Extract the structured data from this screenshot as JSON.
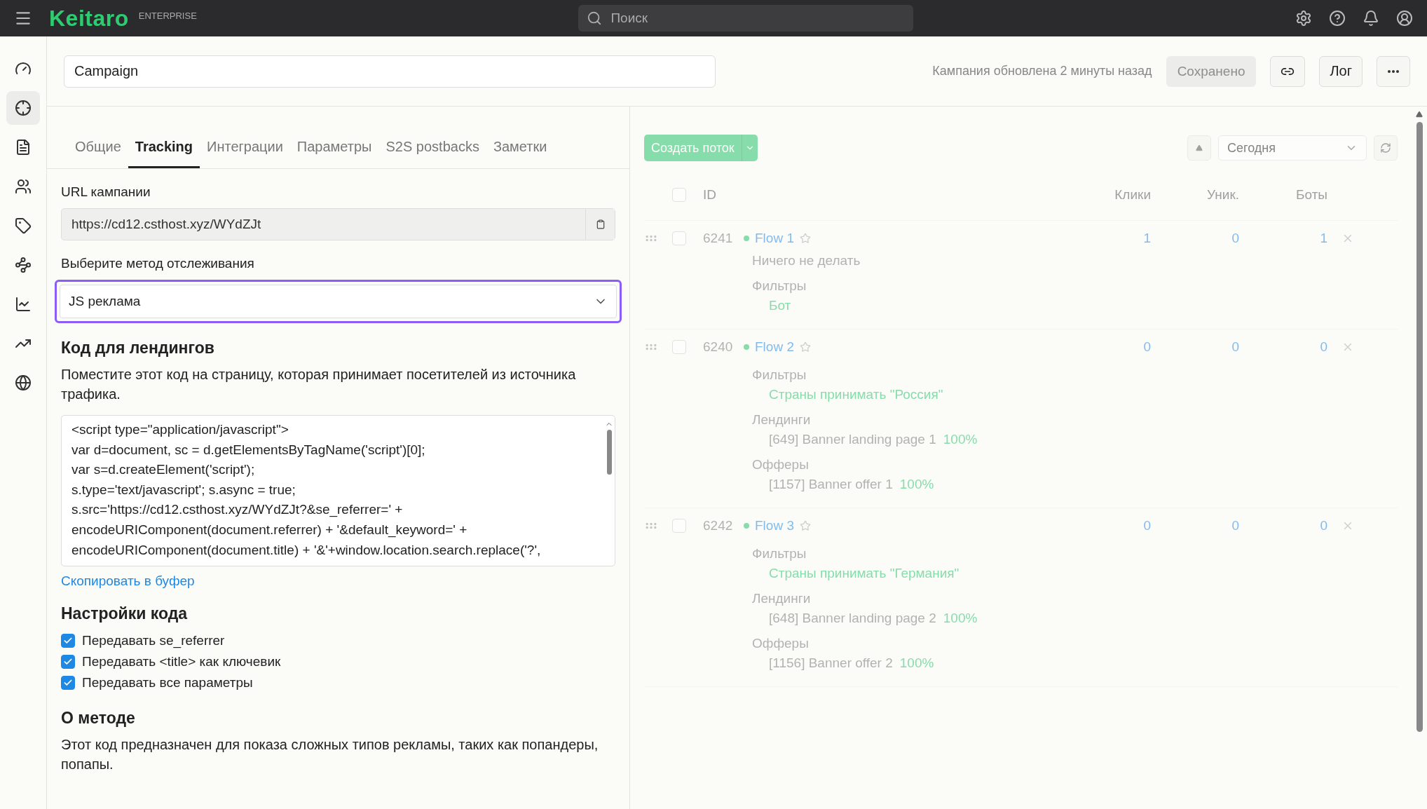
{
  "topbar": {
    "logo": "Keitaro",
    "edition": "ENTERPRISE",
    "search_placeholder": "Поиск"
  },
  "sidebar": {
    "items": [
      {
        "kind": "gauge",
        "selected": false
      },
      {
        "kind": "target",
        "selected": true
      },
      {
        "kind": "list",
        "selected": false
      },
      {
        "kind": "users",
        "selected": false
      },
      {
        "kind": "tag",
        "selected": false
      },
      {
        "kind": "route",
        "selected": false
      },
      {
        "kind": "chart",
        "selected": false
      },
      {
        "kind": "trend",
        "selected": false
      },
      {
        "kind": "globe",
        "selected": false
      }
    ]
  },
  "header": {
    "campaign_name": "Campaign",
    "status": "Кампания обновлена 2 минуты назад",
    "save_button": {
      "label": "Сохранено",
      "disabled": true
    },
    "log_button": "Лог"
  },
  "tabs": [
    {
      "label": "Общие",
      "selected": false
    },
    {
      "label": "Tracking",
      "selected": true
    },
    {
      "label": "Интеграции",
      "selected": false
    },
    {
      "label": "Параметры",
      "selected": false
    },
    {
      "label": "S2S postbacks",
      "selected": false
    },
    {
      "label": "Заметки",
      "selected": false
    }
  ],
  "tracking": {
    "url_label": "URL кампании",
    "url_value": "https://cd12.csthost.xyz/WYdZJt",
    "method_label": "Выберите метод отслеживания",
    "method_value": "JS реклама",
    "code_heading": "Код для лендингов",
    "code_description": "Поместите этот код на страницу, которая принимает посетителей из источника трафика.",
    "code_lines": [
      "<script type=\"application/javascript\">",
      "var d=document, sc = d.getElementsByTagName('script')[0];",
      "var s=d.createElement('script');",
      "s.type='text/javascript'; s.async = true;",
      "s.src='https://cd12.csthost.xyz/WYdZJt?&se_referrer=' +",
      "encodeURIComponent(document.referrer) + '&default_keyword=' +",
      "encodeURIComponent(document.title) + '&'+window.location.search.replace('?',"
    ],
    "copy_link": "Скопировать в буфер",
    "settings_heading": "Настройки кода",
    "options": [
      {
        "label": "Передавать se_referrer",
        "checked": true
      },
      {
        "label": "Передавать <title> как ключевик",
        "checked": true
      },
      {
        "label": "Передавать все параметры",
        "checked": true
      }
    ],
    "about_heading": "О методе",
    "about_text": "Этот код предназначен для показа сложных типов рекламы, таких как попандеры, попапы."
  },
  "flows_panel": {
    "loading": true,
    "create_button": "Создать поток",
    "period": "Сегодня",
    "columns": [
      "ID",
      "Клики",
      "Уник.",
      "Боты"
    ],
    "flows": [
      {
        "id": "6241",
        "name": "Flow 1",
        "active": true,
        "clicks": "1",
        "unique": "0",
        "bots": "1",
        "note": "Ничего не делать",
        "sections": [
          {
            "title": "Фильтры",
            "items": [
              {
                "text": "Бот"
              }
            ]
          }
        ]
      },
      {
        "id": "6240",
        "name": "Flow 2",
        "active": true,
        "clicks": "0",
        "unique": "0",
        "bots": "0",
        "sections": [
          {
            "title": "Фильтры",
            "items": [
              {
                "text": "Страны принимать \"Россия\""
              }
            ]
          },
          {
            "title": "Лендинги",
            "items": [
              {
                "text": "[649] Banner landing page 1",
                "share": "100%"
              }
            ]
          },
          {
            "title": "Офферы",
            "items": [
              {
                "text": "[1157] Banner offer 1",
                "share": "100%"
              }
            ]
          }
        ]
      },
      {
        "id": "6242",
        "name": "Flow 3",
        "active": true,
        "clicks": "0",
        "unique": "0",
        "bots": "0",
        "sections": [
          {
            "title": "Фильтры",
            "items": [
              {
                "text": "Страны принимать \"Германия\""
              }
            ]
          },
          {
            "title": "Лендинги",
            "items": [
              {
                "text": "[648] Banner landing page 2",
                "share": "100%"
              }
            ]
          },
          {
            "title": "Офферы",
            "items": [
              {
                "text": "[1156] Banner offer 2",
                "share": "100%"
              }
            ]
          }
        ]
      }
    ]
  }
}
